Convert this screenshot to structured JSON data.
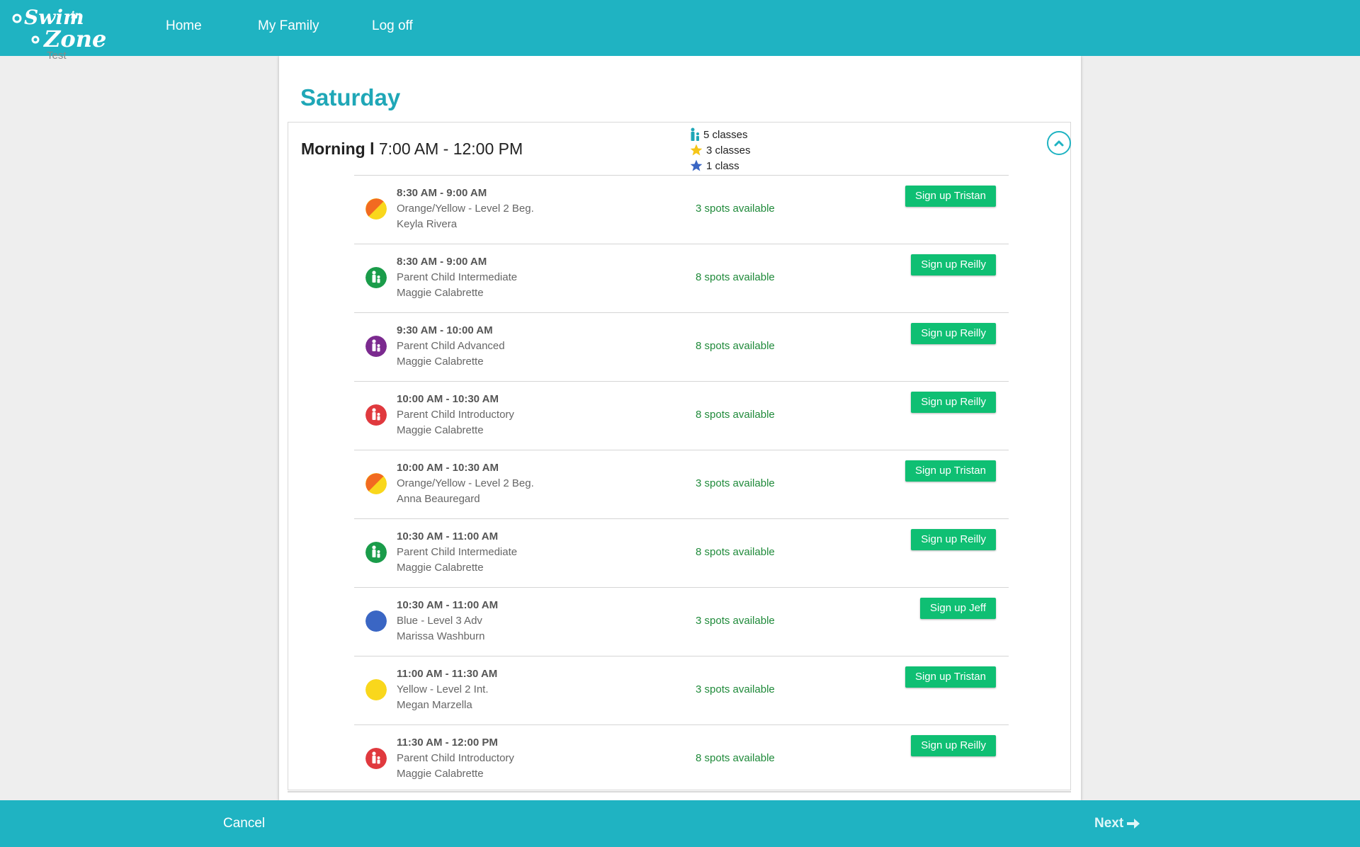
{
  "header": {
    "logo_text": "Swim-in Zone",
    "logo_subtext": "Test",
    "nav": [
      {
        "label": "Home"
      },
      {
        "label": "My Family"
      },
      {
        "label": "Log off"
      }
    ]
  },
  "day": {
    "title": "Saturday",
    "session": {
      "period": "Morning l",
      "time_range": "7:00 AM - 12:00 PM",
      "summary": [
        {
          "icon": "parent-child-icon",
          "color": "#1fa7b7",
          "text": "5 classes"
        },
        {
          "icon": "star-icon",
          "color": "#f5c518",
          "text": "3 classes"
        },
        {
          "icon": "star-icon",
          "color": "#3a66c4",
          "text": "1 class"
        }
      ],
      "classes": [
        {
          "time": "8:30 AM - 9:00 AM",
          "name": "Orange/Yellow - Level 2 Beg.",
          "instructor": "Keyla Rivera",
          "spots": "3 spots available",
          "button": "Sign up Tristan",
          "icon": "orange-yellow"
        },
        {
          "time": "8:30 AM - 9:00 AM",
          "name": "Parent Child Intermediate",
          "instructor": "Maggie Calabrette",
          "spots": "8 spots available",
          "button": "Sign up Reilly",
          "icon": "parent-green"
        },
        {
          "time": "9:30 AM - 10:00 AM",
          "name": "Parent Child Advanced",
          "instructor": "Maggie Calabrette",
          "spots": "8 spots available",
          "button": "Sign up Reilly",
          "icon": "parent-purple"
        },
        {
          "time": "10:00 AM - 10:30 AM",
          "name": "Parent Child Introductory",
          "instructor": "Maggie Calabrette",
          "spots": "8 spots available",
          "button": "Sign up Reilly",
          "icon": "parent-red"
        },
        {
          "time": "10:00 AM - 10:30 AM",
          "name": "Orange/Yellow - Level 2 Beg.",
          "instructor": "Anna Beauregard",
          "spots": "3 spots available",
          "button": "Sign up Tristan",
          "icon": "orange-yellow"
        },
        {
          "time": "10:30 AM - 11:00 AM",
          "name": "Parent Child Intermediate",
          "instructor": "Maggie Calabrette",
          "spots": "8 spots available",
          "button": "Sign up Reilly",
          "icon": "parent-green"
        },
        {
          "time": "10:30 AM - 11:00 AM",
          "name": "Blue - Level 3 Adv",
          "instructor": "Marissa Washburn",
          "spots": "3 spots available",
          "button": "Sign up Jeff",
          "icon": "blue"
        },
        {
          "time": "11:00 AM - 11:30 AM",
          "name": "Yellow - Level 2 Int.",
          "instructor": "Megan Marzella",
          "spots": "3 spots available",
          "button": "Sign up Tristan",
          "icon": "yellow"
        },
        {
          "time": "11:30 AM - 12:00 PM",
          "name": "Parent Child Introductory",
          "instructor": "Maggie Calabrette",
          "spots": "8 spots available",
          "button": "Sign up Reilly",
          "icon": "parent-red"
        }
      ]
    }
  },
  "footer": {
    "cancel_label": "Cancel",
    "next_label": "Next"
  },
  "colors": {
    "brand": "#1fb3c2",
    "signup": "#0fbf73",
    "spots": "#1f8a3a",
    "orange": "#f26a21",
    "yellow": "#f9d71c",
    "green": "#1a9c4a",
    "purple": "#7b2a8f",
    "red": "#e0393e",
    "blue": "#3a66c4"
  }
}
